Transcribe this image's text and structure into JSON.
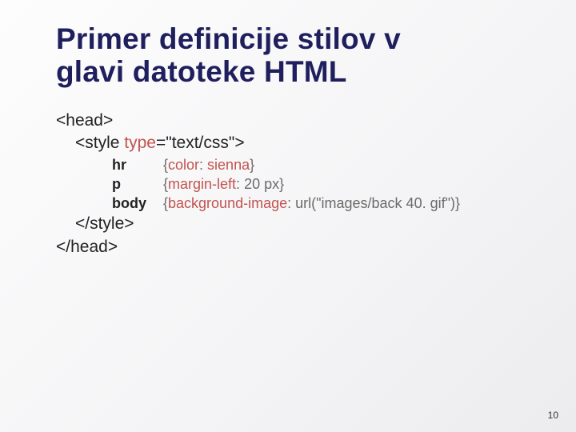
{
  "title_line1": "Primer definicije stilov v",
  "title_line2": "glavi datoteke HTML",
  "code": {
    "head_open": "<head>",
    "style_open_a": "<style ",
    "style_attr_name": "type",
    "style_eq": "=",
    "style_attr_val": "\"text/css\"",
    "style_open_b": ">",
    "rules": [
      {
        "selector": "hr",
        "lbr": "{",
        "prop": "color",
        "colon": ": ",
        "val": "sienna",
        "rbr": "}"
      },
      {
        "selector": "p",
        "lbr": "{",
        "prop": "margin-left",
        "colon": ": ",
        "val": "20 px",
        "rbr": "}"
      },
      {
        "selector": "body",
        "lbr": "{",
        "prop": "background-image",
        "colon": ": ",
        "val": "url(\"images/back 40. gif\")",
        "rbr": "}"
      }
    ],
    "style_close": "</style>",
    "head_close": "</head>"
  },
  "page_number": "10"
}
